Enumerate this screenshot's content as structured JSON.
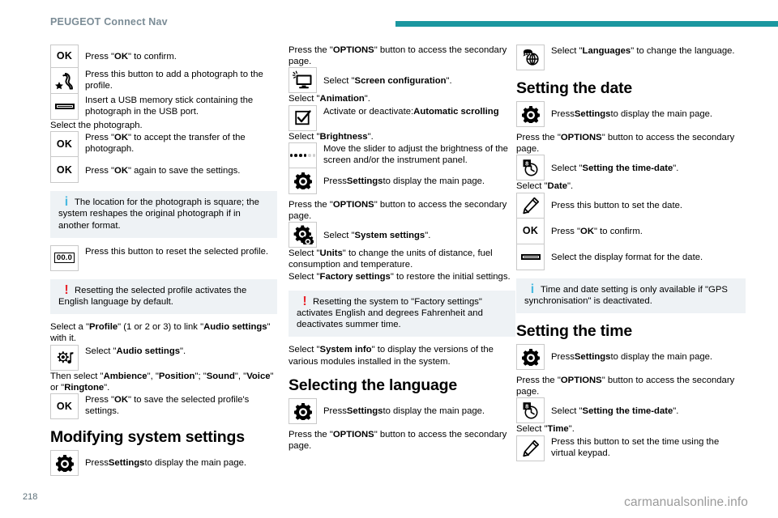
{
  "header": {
    "title": "PEUGEOT Connect Nav",
    "rule_color": "#1b97a0"
  },
  "footer": {
    "page_number": "218",
    "watermark": "carmanualsonline.info"
  },
  "columns": {
    "left": {
      "rows": [
        {
          "icon": "ok-button-icon",
          "icon_label": "OK",
          "text_html": "Press \"<b>OK</b>\" to confirm."
        },
        {
          "icon": "profile-photo-icon",
          "text_html": "Press this button to add a photograph to the profile."
        },
        {
          "icon": "usb-stick-icon",
          "text_html": "Insert a USB memory stick containing the photograph in the USB port."
        }
      ],
      "p_select_photo": "Select the photograph.",
      "rows2": [
        {
          "icon": "ok-button-icon",
          "icon_label": "OK",
          "text_html": "Press \"<b>OK</b>\" to accept the transfer of the photograph."
        },
        {
          "icon": "ok-button-icon",
          "icon_label": "OK",
          "text_html": "Press \"<b>OK</b>\" again to save the settings."
        }
      ],
      "notice_info": "The location for the photograph is square; the system reshapes the original photograph if in another format.",
      "row_reset": {
        "icon": "reset-counter-icon",
        "icon_label": "00.0",
        "text_html": "Press this button to reset the selected profile."
      },
      "notice_warn": "Resetting the selected profile activates the English language by default.",
      "p_profile_html": "Select a \"<b>Profile</b>\" (1 or 2 or 3) to link \"<b>Audio settings</b>\" with it.",
      "row_audio": {
        "icon": "audio-settings-icon",
        "text_html": "Select \"<b>Audio settings</b>\"."
      },
      "p_then_select_html": "Then select \"<b>Ambience</b>\", \"<b>Position</b>\"; \"<b>Sound</b>\", \"<b>Voice</b>\" or \"<b>Ringtone</b>\".",
      "row_ok_save": {
        "icon": "ok-button-icon",
        "icon_label": "OK",
        "text_html": "Press \"<b>OK</b>\" to save the selected profile's settings."
      },
      "heading_modify": "Modifying system settings",
      "row_settings": {
        "icon": "settings-gear-icon",
        "text_html": "Press <b>Settings</b> to display the main page."
      }
    },
    "mid": {
      "p_options_html": "Press the \"<b>OPTIONS</b>\" button to access the secondary page.",
      "row_screen_config": {
        "icon": "screen-configuration-icon",
        "text_html": "Select \"<b>Screen configuration</b>\"."
      },
      "p_animation_html": "Select \"<b>Animation</b>\".",
      "row_checkbox": {
        "icon": "checkbox-icon",
        "text_html": "Activate or deactivate:<b>Automatic scrolling</b>"
      },
      "p_brightness_html": "Select \"<b>Brightness</b>\".",
      "row_slider": {
        "icon": "brightness-slider-icon",
        "text_html": "Move the slider to adjust the brightness of the screen and/or the instrument panel."
      },
      "row_settings": {
        "icon": "settings-gear-icon",
        "text_html": "Press <b>Settings</b> to display the main page."
      },
      "p_options2_html": "Press the \"<b>OPTIONS</b>\" button to access the secondary page.",
      "row_system_settings": {
        "icon": "system-settings-icon",
        "text_html": "Select \"<b>System settings</b>\"."
      },
      "p_units_html": "Select \"<b>Units</b>\" to change the units of distance, fuel consumption and temperature.",
      "p_factory_html": "Select \"<b>Factory settings</b>\" to restore the initial settings.",
      "notice_warn": "Resetting the system to \"Factory settings\" activates English and degrees Fahrenheit and deactivates summer time.",
      "p_sysinfo_html": "Select \"<b>System info</b>\" to display the versions of the various modules installed in the system.",
      "heading_language": "Selecting the language",
      "row_settings2": {
        "icon": "settings-gear-icon",
        "text_html": "Press <b>Settings</b> to display the main page."
      },
      "p_options3_html": "Press the \"<b>OPTIONS</b>\" button to access the secondary page."
    },
    "right": {
      "row_language": {
        "icon": "language-globe-icon",
        "text_html": "Select \"<b>Languages</b>\" to change the language."
      },
      "heading_date": "Setting the date",
      "row_settings": {
        "icon": "settings-gear-icon",
        "text_html": "Press <b>Settings</b> to display the main page."
      },
      "p_options_html": "Press the \"<b>OPTIONS</b>\" button to access the secondary page.",
      "row_time_date": {
        "icon": "time-date-icon",
        "text_html": "Select \"<b>Setting the time-date</b>\"."
      },
      "p_date_html": "Select \"<b>Date</b>\".",
      "row_pencil": {
        "icon": "pencil-edit-icon",
        "text_html": "Press this button to set the date."
      },
      "row_ok": {
        "icon": "ok-button-icon",
        "icon_label": "OK",
        "text_html": "Press \"<b>OK</b>\" to confirm."
      },
      "row_format": {
        "icon": "display-format-icon",
        "text_html": "Select the display format for the date."
      },
      "notice_info": "Time and date setting is only available if \"GPS synchronisation\" is deactivated.",
      "heading_time": "Setting the time",
      "row_settings2": {
        "icon": "settings-gear-icon",
        "text_html": "Press <b>Settings</b> to display the main page."
      },
      "p_options2_html": "Press the \"<b>OPTIONS</b>\" button to access the secondary page.",
      "row_time_date2": {
        "icon": "time-date-icon",
        "text_html": "Select \"<b>Setting the time-date</b>\"."
      },
      "p_time_html": "Select \"<b>Time</b>\".",
      "row_pencil2": {
        "icon": "pencil-edit-icon",
        "text_html": "Press this button to set the time using the virtual keypad."
      }
    }
  }
}
